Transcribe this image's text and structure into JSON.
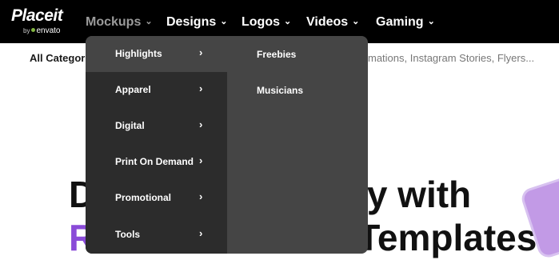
{
  "logo": {
    "name": "Placeit",
    "by": "by",
    "parent": "envato"
  },
  "nav": [
    {
      "label": "Mockups",
      "active": true
    },
    {
      "label": "Designs"
    },
    {
      "label": "Logos"
    },
    {
      "label": "Videos"
    },
    {
      "label": "Gaming"
    }
  ],
  "nav_chevron": "⌄",
  "search": {
    "category": "All Categories",
    "placeholder_visible": "mations, Instagram Stories, Flyers..."
  },
  "hero": {
    "line1_a": "D",
    "line1_b": "sy with",
    "line2_accent": "R",
    "line2_b": "Templates!"
  },
  "dropdown": {
    "chevron": "›",
    "categories": [
      {
        "label": "Highlights",
        "active": true
      },
      {
        "label": "Apparel"
      },
      {
        "label": "Digital"
      },
      {
        "label": "Print On Demand"
      },
      {
        "label": "Promotional"
      },
      {
        "label": "Tools"
      }
    ],
    "submenu": [
      {
        "label": "Freebies"
      },
      {
        "label": "Musicians"
      }
    ]
  },
  "colors": {
    "topbar": "#000000",
    "dropdown_left": "#2c2c2c",
    "dropdown_right": "#454545",
    "hero_accent": "#8a4bd8",
    "envato_green": "#82b541"
  }
}
